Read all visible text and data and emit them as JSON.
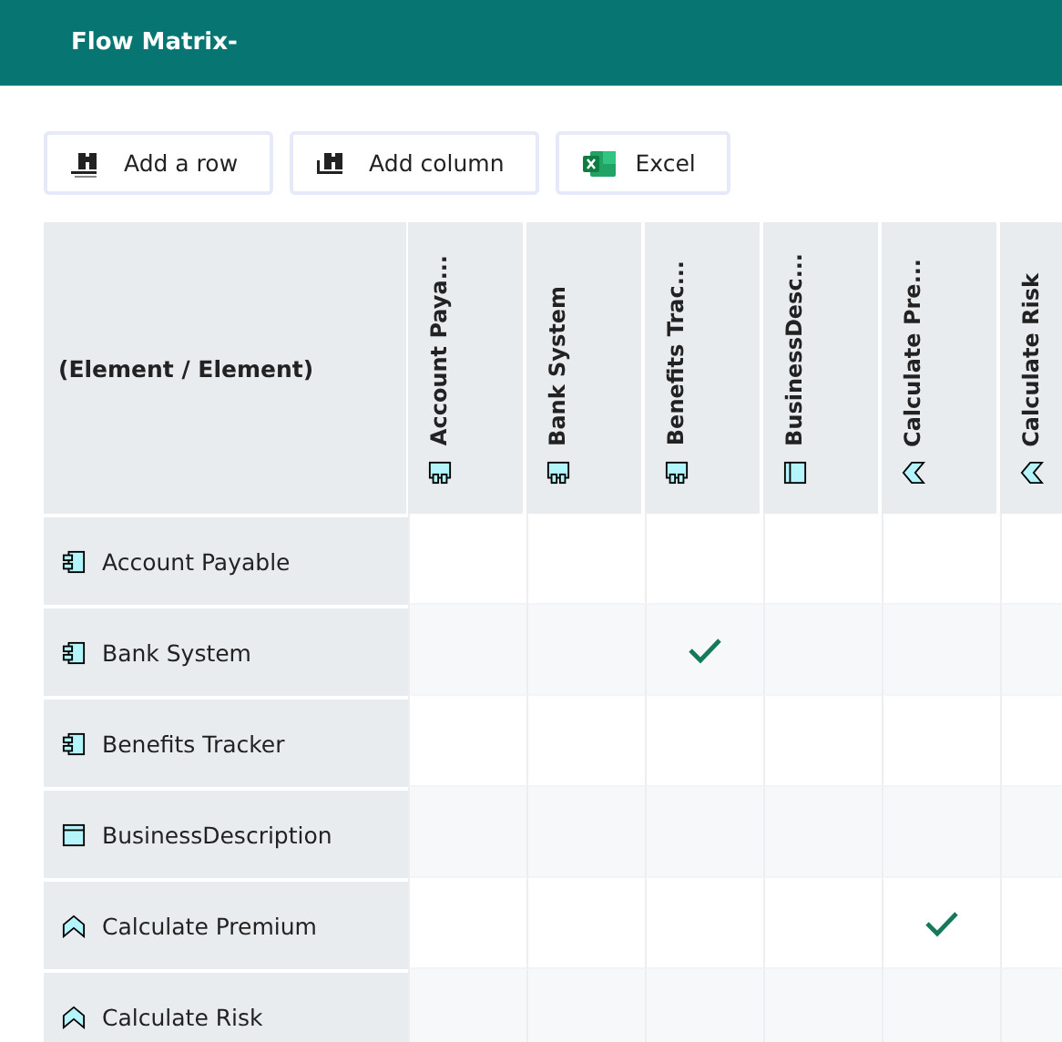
{
  "header": {
    "title": "Flow Matrix-"
  },
  "toolbar": [
    {
      "kind": "add-row",
      "label": "Add a row"
    },
    {
      "kind": "add-column",
      "label": "Add column"
    },
    {
      "kind": "excel",
      "label": "Excel"
    }
  ],
  "matrix": {
    "corner": "(Element / Element)",
    "columns": [
      {
        "label": "Account Paya...",
        "kind": "component"
      },
      {
        "label": "Bank System",
        "kind": "component"
      },
      {
        "label": "Benefits Trac...",
        "kind": "component"
      },
      {
        "label": "BusinessDesc...",
        "kind": "object"
      },
      {
        "label": "Calculate Pre...",
        "kind": "function"
      },
      {
        "label": "Calculate Risk",
        "kind": "function"
      }
    ],
    "rows": [
      {
        "label": "Account Payable",
        "kind": "component",
        "cells": [
          false,
          false,
          false,
          false,
          false,
          false
        ]
      },
      {
        "label": "Bank System",
        "kind": "component",
        "cells": [
          false,
          false,
          true,
          false,
          false,
          false
        ]
      },
      {
        "label": "Benefits Tracker",
        "kind": "component",
        "cells": [
          false,
          false,
          false,
          false,
          false,
          false
        ]
      },
      {
        "label": "BusinessDescription",
        "kind": "object",
        "cells": [
          false,
          false,
          false,
          false,
          false,
          false
        ]
      },
      {
        "label": "Calculate Premium",
        "kind": "function",
        "cells": [
          false,
          false,
          false,
          false,
          true,
          false
        ]
      },
      {
        "label": "Calculate Risk",
        "kind": "function",
        "cells": [
          false,
          false,
          false,
          false,
          false,
          false
        ]
      }
    ]
  }
}
